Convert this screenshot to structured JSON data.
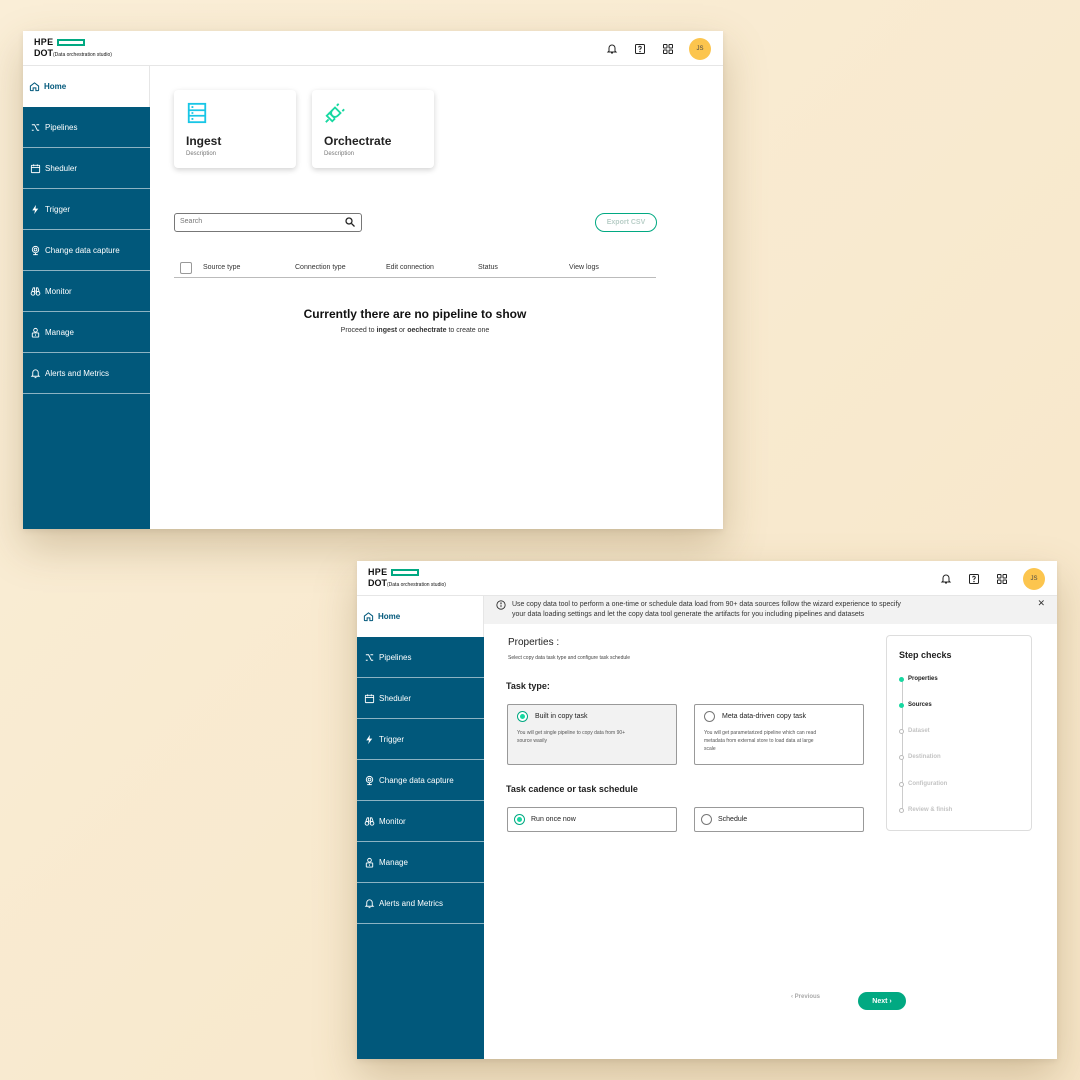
{
  "brand": {
    "hpe": "HPE",
    "dot": "DOT",
    "dot_sub": "(Data orchestration studio)",
    "accent_color": "#01a982",
    "sidebar_color": "#01587b"
  },
  "header": {
    "avatar_initials": "JS"
  },
  "sidebar": {
    "home": "Home",
    "items": [
      {
        "label": "Pipelines",
        "icon": "pipelines-icon"
      },
      {
        "label": "Sheduler",
        "icon": "calendar-icon"
      },
      {
        "label": "Trigger",
        "icon": "lightning-icon"
      },
      {
        "label": "Change data capture",
        "icon": "webcam-icon"
      },
      {
        "label": "Monitor",
        "icon": "binoculars-icon"
      },
      {
        "label": "Manage",
        "icon": "user-lock-icon"
      },
      {
        "label": "Alerts and Metrics",
        "icon": "bell-icon"
      }
    ]
  },
  "screen1": {
    "cards": [
      {
        "title": "Ingest",
        "desc": "Description"
      },
      {
        "title": "Orchectrate",
        "desc": "Description"
      }
    ],
    "search_placeholder": "Search",
    "export_label": "Export CSV",
    "columns": [
      "Source type",
      "Connection type",
      "Edit connection",
      "Status",
      "View logs"
    ],
    "empty_title": "Currently there are no pipeline to show",
    "empty_pre": "Proceed to ",
    "empty_link1": "ingest",
    "empty_mid": " or ",
    "empty_link2": "oechectrate",
    "empty_post": " to create one"
  },
  "screen2": {
    "banner_line1": "Use copy data tool to perform a one-time or schedule data load from 90+ data sources follow the wizard experience to specify",
    "banner_line2": "your data loading settings and let the copy data tool generate the artifacts for you including pipelines and datasets",
    "props_title": "Properties :",
    "props_sub": "Select copy data task type and  configure task schedule",
    "task_type_title": "Task type:",
    "opt_builtin_label": "Built in copy task",
    "opt_builtin_desc1": "You will get single pipeline  to copy data from 90+",
    "opt_builtin_desc2": "source wasily",
    "opt_meta_label": "Meta data-driven copy task",
    "opt_meta_desc1": "You will get parametarized pipeline which can read",
    "opt_meta_desc2": "metadata from external store to load data at large",
    "opt_meta_desc3": "scale",
    "cadence_title": "Task cadence or task schedule",
    "opt_runonce": "Run once now",
    "opt_schedule": "Schedule",
    "steps_title": "Step checks",
    "steps": [
      {
        "label": "Properties",
        "done": true
      },
      {
        "label": "Sources",
        "done": true
      },
      {
        "label": "Dataset",
        "done": false
      },
      {
        "label": "Destination",
        "done": false
      },
      {
        "label": "Configuration",
        "done": false
      },
      {
        "label": "Review & finish",
        "done": false
      }
    ],
    "prev_label": "‹  Previous",
    "next_label": "Next  ›"
  }
}
